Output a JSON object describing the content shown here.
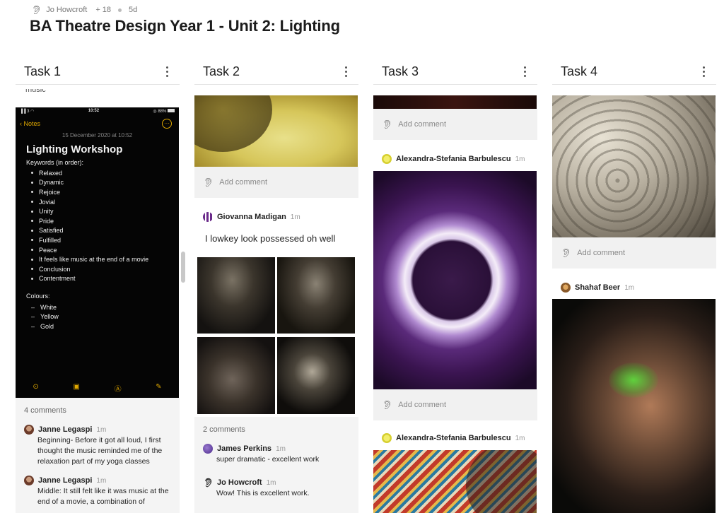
{
  "board": {
    "author": "Jo Howcroft",
    "contributors": "+ 18",
    "age": "5d",
    "title": "BA Theatre Design Year 1 - Unit 2: Lighting"
  },
  "columns": [
    {
      "title": "Task 1"
    },
    {
      "title": "Task 2"
    },
    {
      "title": "Task 3"
    },
    {
      "title": "Task 4"
    }
  ],
  "task1": {
    "clipped_text": "music",
    "phone": {
      "status_left": "3",
      "status_time": "10:52",
      "status_right": "88%",
      "back_label": "Notes",
      "more_icon": "···",
      "date": "15 December 2020 at 10:52",
      "note_title": "Lighting Workshop",
      "keywords_label": "Keywords (in order):",
      "keywords": [
        "Relaxed",
        "Dynamic",
        "Rejoice",
        "Jovial",
        "Unity",
        "Pride",
        "Satisfied",
        "Fulfilled",
        "Peace",
        "It feels like music at the end of a movie",
        "Conclusion",
        "Contentment"
      ],
      "colours_label": "Colours:",
      "colours": [
        "White",
        "Yellow",
        "Gold"
      ]
    },
    "comments_count": "4 comments",
    "comments": [
      {
        "author": "Janne Legaspi",
        "time": "1m",
        "text": "Beginning- Before it got all loud, I first thought the music reminded me of the relaxation part of my yoga classes"
      },
      {
        "author": "Janne Legaspi",
        "time": "1m",
        "text": "Middle: It still felt like it was music at the end of a movie, a combination of"
      }
    ]
  },
  "task2": {
    "add_comment": "Add comment",
    "post_author": "Giovanna Madigan",
    "post_time": "1m",
    "post_text": "I lowkey look possessed oh well",
    "comments_count": "2 comments",
    "comments": [
      {
        "author": "James Perkins",
        "time": "1m",
        "text": "super dramatic - excellent work"
      },
      {
        "author": "Jo Howcroft",
        "time": "1m",
        "text": "Wow! This is excellent work."
      }
    ]
  },
  "task3": {
    "add_comment_1": "Add comment",
    "post1_author": "Alexandra-Stefania Barbulescu",
    "post1_time": "1m",
    "add_comment_2": "Add comment",
    "post2_author": "Alexandra-Stefania Barbulescu",
    "post2_time": "1m"
  },
  "task4": {
    "add_comment": "Add comment",
    "post_author": "Shahaf Beer",
    "post_time": "1m"
  },
  "colors": {
    "note_accent": "#e0a800",
    "add_comment_bg": "#f1f1f1",
    "comments_bg": "#f4f4f4"
  },
  "icons": {
    "ear": "ear-icon",
    "menu": "kebab-menu-icon"
  }
}
